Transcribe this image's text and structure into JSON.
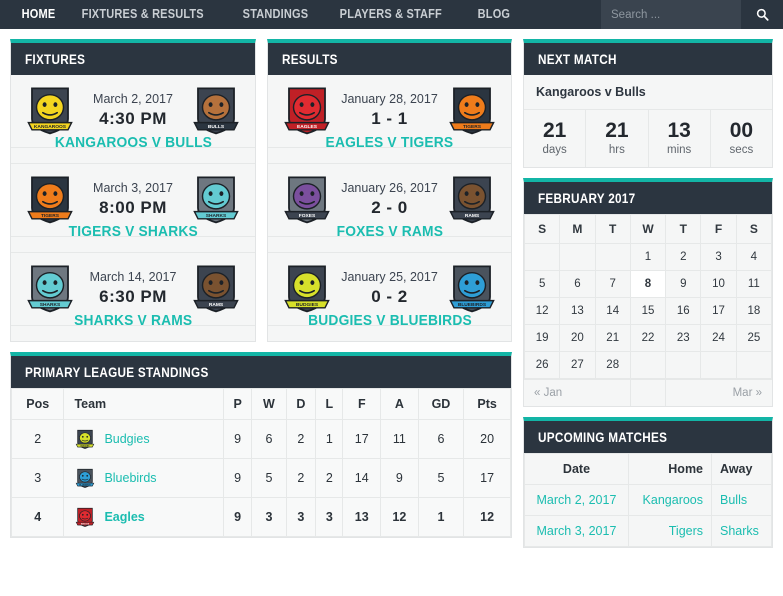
{
  "nav": {
    "items": [
      {
        "label": "Home",
        "active": true
      },
      {
        "label": "Fixtures & Results",
        "active": false
      },
      {
        "label": "Standings",
        "active": false
      },
      {
        "label": "Players & Staff",
        "active": false
      },
      {
        "label": "Blog",
        "active": false
      }
    ],
    "search_placeholder": "Search ...",
    "search_value": "",
    "search_icon": "search-icon"
  },
  "fixtures": {
    "title": "Fixtures",
    "matches": [
      {
        "date": "March 2, 2017",
        "time": "4:30 PM",
        "teams": "Kangaroos v Bulls",
        "home": "kangaroos",
        "away": "bulls"
      },
      {
        "date": "March 3, 2017",
        "time": "8:00 PM",
        "teams": "Tigers v Sharks",
        "home": "tigers",
        "away": "sharks"
      },
      {
        "date": "March 14, 2017",
        "time": "6:30 PM",
        "teams": "Sharks v Rams",
        "home": "sharks",
        "away": "rams"
      }
    ]
  },
  "results": {
    "title": "Results",
    "matches": [
      {
        "date": "January 28, 2017",
        "score": "1 - 1",
        "teams": "Eagles v Tigers",
        "home": "eagles",
        "away": "tigers"
      },
      {
        "date": "January 26, 2017",
        "score": "2 - 0",
        "teams": "Foxes v Rams",
        "home": "foxes",
        "away": "rams"
      },
      {
        "date": "January 25, 2017",
        "score": "0 - 2",
        "teams": "Budgies v Bluebirds",
        "home": "budgies",
        "away": "bluebirds"
      }
    ]
  },
  "next_match": {
    "title": "Next Match",
    "match": "Kangaroos v Bulls",
    "countdown": [
      {
        "value": "21",
        "label": "days"
      },
      {
        "value": "21",
        "label": "hrs"
      },
      {
        "value": "13",
        "label": "mins"
      },
      {
        "value": "00",
        "label": "secs"
      }
    ]
  },
  "calendar": {
    "title": "February 2017",
    "weekdays": [
      "S",
      "M",
      "T",
      "W",
      "T",
      "F",
      "S"
    ],
    "weeks": [
      [
        "",
        "",
        "",
        "1",
        "2",
        "3",
        "4"
      ],
      [
        "5",
        "6",
        "7",
        "8",
        "9",
        "10",
        "11"
      ],
      [
        "12",
        "13",
        "14",
        "15",
        "16",
        "17",
        "18"
      ],
      [
        "19",
        "20",
        "21",
        "22",
        "23",
        "24",
        "25"
      ],
      [
        "26",
        "27",
        "28",
        "",
        "",
        "",
        ""
      ]
    ],
    "today": "8",
    "prev_label": "« Jan",
    "next_label": "Mar »"
  },
  "standings": {
    "title": "Primary League Standings",
    "columns": [
      "Pos",
      "Team",
      "P",
      "W",
      "D",
      "L",
      "F",
      "A",
      "GD",
      "Pts"
    ],
    "rows": [
      {
        "pos": "2",
        "team": "Budgies",
        "crest": "budgies",
        "p": "9",
        "w": "6",
        "d": "2",
        "l": "1",
        "f": "17",
        "a": "11",
        "gd": "6",
        "pts": "20",
        "highlight": false
      },
      {
        "pos": "3",
        "team": "Bluebirds",
        "crest": "bluebirds",
        "p": "9",
        "w": "5",
        "d": "2",
        "l": "2",
        "f": "14",
        "a": "9",
        "gd": "5",
        "pts": "17",
        "highlight": false
      },
      {
        "pos": "4",
        "team": "Eagles",
        "crest": "eagles",
        "p": "9",
        "w": "3",
        "d": "3",
        "l": "3",
        "f": "13",
        "a": "12",
        "gd": "1",
        "pts": "12",
        "highlight": true
      }
    ]
  },
  "upcoming": {
    "title": "Upcoming Matches",
    "columns": [
      "Date",
      "Home",
      "Away"
    ],
    "rows": [
      {
        "date": "March 2, 2017",
        "home": "Kangaroos",
        "away": "Bulls"
      },
      {
        "date": "March 3, 2017",
        "home": "Tigers",
        "away": "Sharks"
      }
    ]
  },
  "colors": {
    "accent": "#13b5a6",
    "link": "#1bbdb0",
    "header_dark": "#2b3540",
    "panel_bg": "#f5f6f6"
  }
}
